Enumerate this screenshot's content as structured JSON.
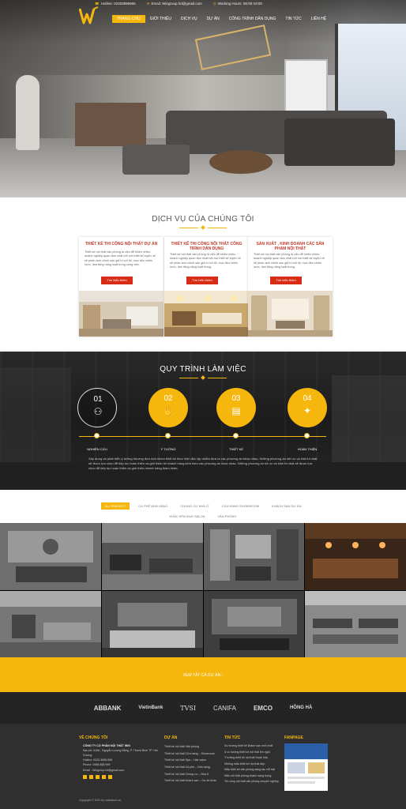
{
  "topbar": {
    "hotline": "Hotline: 02203896965",
    "email": "Email: Wingroup.hd@gmail.com",
    "hours": "Working Hours: 08:00-19:00"
  },
  "nav": {
    "items": [
      "TRANG CHỦ",
      "GIỚI THIỆU",
      "DỊCH VỤ",
      "DỰ ÁN",
      "CÔNG TRÌNH DÂN DỤNG",
      "TIN TỨC",
      "LIÊN HỆ"
    ],
    "active_index": 0
  },
  "services": {
    "title": "DỊCH VỤ CỦA CHÚNG TÔI",
    "cards": [
      {
        "title": "THIẾT KẾ THI CÔNG NỘI THẤT DỰ ÁN",
        "desc": "Thiết kế nội thất văn phòng là việc để khiến nhiều doanh nghiệp quan tâm nhất bởi nơi thiết kế luyện về sẽ phản ánh chính sác giá trị cốt lõi, mục tiêu chiến lược, làm tăng năng suất trong công việc.",
        "button": "Tìm hiểu thêm"
      },
      {
        "title": "THIẾT KẾ THI CÔNG NỘI THẤT CÔNG TRÌNH DÂN DỤNG",
        "desc": "Thiết kế nội thất văn phòng là việc để khiến nhiều doanh nghiệp quan tâm nhất bởi nơi thiết kế luyện về sẽ phản ánh chính sác giá trị cốt lõi, mục tiêu chiến lược, làm tăng năng suất trong.",
        "button": "Tìm hiểu thêm"
      },
      {
        "title": "SẢN XUẤT , KINH DOANH CÁC SẢN PHẨM NỘI THẤT",
        "desc": "Thiết kế nội thất văn phòng là việc để khiến nhiều doanh nghiệp quan tâm nhất bởi nơi thiết kế luyện về sẽ phản ánh chính sác giá trị cốt lõi, mục tiêu chiến lược, làm tăng năng suất trong.",
        "button": "Tìm hiểu thêm"
      }
    ]
  },
  "process": {
    "title": "QUY TRÌNH LÀM VIỆC",
    "steps": [
      {
        "num": "01",
        "label": "NGHIÊN CỨU",
        "icon": "team-icon"
      },
      {
        "num": "02",
        "label": "Ý TƯỞNG",
        "icon": "idea-icon"
      },
      {
        "num": "03",
        "label": "THIẾT KẾ",
        "icon": "design-icon"
      },
      {
        "num": "04",
        "label": "HOÀN THIỆN",
        "icon": "handover-icon"
      }
    ],
    "desc": "Xây dựng và phát triển ý tưởng thương đơn một nhóm thiết kế thực hiện độc lập nhằm đưa ra các phương án khác nhau. Những phương án kết ưu và khả thi nhất sẽ được lựa chọn để tiếp tục hoàn thiện và giới thiệu tới khách hàng kèm theo các phương án khác nhau. Những phương án tối ưu và khả thi nhất sẽ được lựa chọn để tiếp tục hoàn thiện và giới thiệu khách hàng tham khảo."
  },
  "projects": {
    "tabs_row1": [
      "ALL PROJECT",
      "CÀ PHÊ NHÀ HÀNG",
      "CHUNG CƯ NHÀ Ở",
      "CỬA HÀNG SHOWROOM",
      "KHÁCH SẠN DỰ ÁN"
    ],
    "tabs_row2": [
      "KHÁC SPA HAIR SALON",
      "VĂN PHÒNG"
    ],
    "active": "ALL PROJECT",
    "view_all": "XEM TẤT CẢ DỰ ÁN"
  },
  "partners": [
    "ABBANK",
    "VietinBank",
    "TVSI",
    "CANIFA",
    "EMCO",
    "HỒNG HÀ"
  ],
  "footer": {
    "about_title": "VỀ CHÚNG TÔI",
    "company": "CÔNG TY CỔ PHẦN NỘI THẤT WIN",
    "address": "Địa chỉ: 418A , Nguyễn Lương Bằng, P. Thanh Bình TP. Hải Dương",
    "hotline": "Hotline: 0220.3896.555",
    "phone": "Phone: 0988.888.999",
    "email": "Email : Wingroup.hd@gmail.com",
    "projects_title": "DỰ ÁN",
    "projects": [
      "Thiết kế nội thất Văn phòng",
      "Thiết kế nội thất Cửa hàng – Showroom",
      "Thiết kế nội thất Spa – Hair salon",
      "Thiết kế nội thất Cà phê – Nhà hàng",
      "Thiết kế nội thất Chung cư – Nhà ở",
      "Thiết kế nội thất Khách sạn – Dự án khác"
    ],
    "news_title": "TIN TỨC",
    "news": [
      "Xu hướng thiết kế khách sạn mới nhất",
      "5 xu hướng thiết kế nội thất lên ngôi",
      "Ý tưởng thiết kế nội thất Hoàn hảo",
      "Những mẫu thiết kế nội thất đẹp",
      "Mẫu thiết kế văn phòng sáng tạo nổi bật",
      "Mẫu nội thất phòng khách sang trọng",
      "Thi công nội thất văn phòng chuyên nghiệp"
    ],
    "fanpage_title": "FANPAGE",
    "copyright": "Copyright © 2021 by noithatwin.vn"
  },
  "colors": {
    "accent": "#f5b60e",
    "red": "#d72c16",
    "dark": "#242424"
  }
}
